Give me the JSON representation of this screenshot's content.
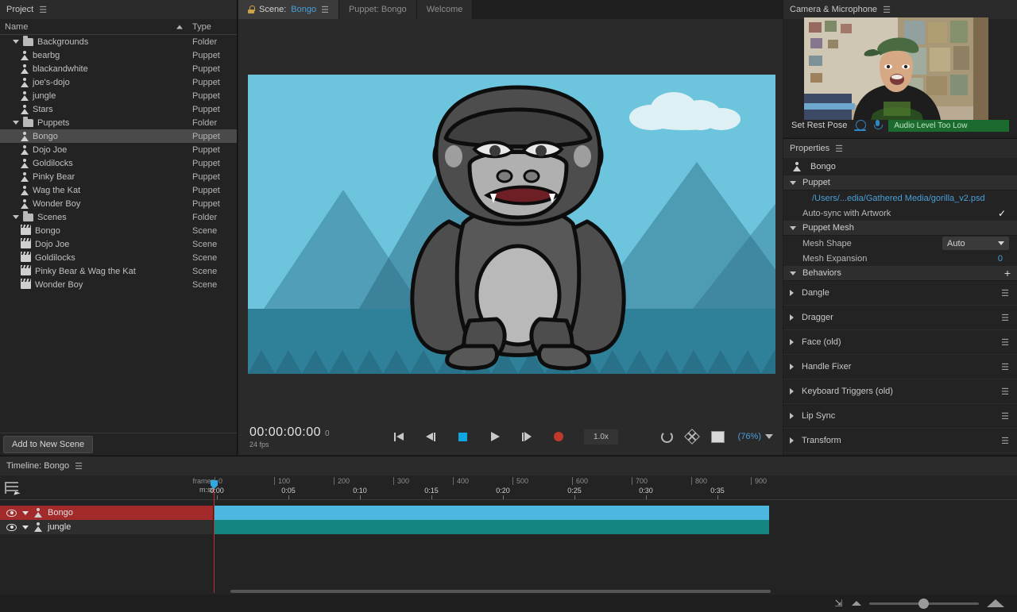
{
  "project": {
    "title": "Project",
    "columns": {
      "name": "Name",
      "type": "Type"
    },
    "add_button": "Add to New Scene",
    "items": [
      {
        "label": "Backgrounds",
        "type": "Folder",
        "kind": "folder",
        "indent": 0,
        "expanded": true,
        "selected": false
      },
      {
        "label": "bearbg",
        "type": "Puppet",
        "kind": "puppet",
        "indent": 1,
        "selected": false
      },
      {
        "label": "blackandwhite",
        "type": "Puppet",
        "kind": "puppet",
        "indent": 1,
        "selected": false
      },
      {
        "label": "joe's-dojo",
        "type": "Puppet",
        "kind": "puppet",
        "indent": 1,
        "selected": false
      },
      {
        "label": "jungle",
        "type": "Puppet",
        "kind": "puppet",
        "indent": 1,
        "selected": false
      },
      {
        "label": "Stars",
        "type": "Puppet",
        "kind": "puppet",
        "indent": 1,
        "selected": false
      },
      {
        "label": "Puppets",
        "type": "Folder",
        "kind": "folder",
        "indent": 0,
        "expanded": true,
        "selected": false
      },
      {
        "label": "Bongo",
        "type": "Puppet",
        "kind": "puppet",
        "indent": 1,
        "selected": true
      },
      {
        "label": "Dojo Joe",
        "type": "Puppet",
        "kind": "puppet",
        "indent": 1,
        "selected": false
      },
      {
        "label": "Goldilocks",
        "type": "Puppet",
        "kind": "puppet",
        "indent": 1,
        "selected": false
      },
      {
        "label": "Pinky Bear",
        "type": "Puppet",
        "kind": "puppet",
        "indent": 1,
        "selected": false
      },
      {
        "label": "Wag the Kat",
        "type": "Puppet",
        "kind": "puppet",
        "indent": 1,
        "selected": false
      },
      {
        "label": "Wonder Boy",
        "type": "Puppet",
        "kind": "puppet",
        "indent": 1,
        "selected": false
      },
      {
        "label": "Scenes",
        "type": "Folder",
        "kind": "folder",
        "indent": 0,
        "expanded": true,
        "selected": false
      },
      {
        "label": "Bongo",
        "type": "Scene",
        "kind": "scene",
        "indent": 1,
        "selected": false
      },
      {
        "label": "Dojo Joe",
        "type": "Scene",
        "kind": "scene",
        "indent": 1,
        "selected": false
      },
      {
        "label": "Goldilocks",
        "type": "Scene",
        "kind": "scene",
        "indent": 1,
        "selected": false
      },
      {
        "label": "Pinky Bear & Wag the Kat",
        "type": "Scene",
        "kind": "scene",
        "indent": 1,
        "selected": false
      },
      {
        "label": "Wonder Boy",
        "type": "Scene",
        "kind": "scene",
        "indent": 1,
        "selected": false
      }
    ]
  },
  "tabs": [
    {
      "prefix": "Scene:",
      "name": "Bongo",
      "active": true,
      "locked": true
    },
    {
      "prefix": "Puppet: Bongo",
      "name": "",
      "active": false,
      "locked": false
    },
    {
      "prefix": "Welcome",
      "name": "",
      "active": false,
      "locked": false
    }
  ],
  "transport": {
    "timecode": "00:00:00:00",
    "frame": "0",
    "fps": "24 fps",
    "speed": "1.0x",
    "zoom": "(76%)",
    "buttons": {
      "go_to_start": "go-to-start",
      "step_back": "step-back",
      "stop": "stop",
      "play": "play",
      "step_forward": "step-forward",
      "record": "record"
    }
  },
  "camera": {
    "title": "Camera & Microphone",
    "set_rest_pose": "Set Rest Pose",
    "audio_status": "Audio Level Too Low"
  },
  "properties": {
    "title": "Properties",
    "puppet_name": "Bongo",
    "sections": {
      "puppet": "Puppet",
      "puppet_mesh": "Puppet Mesh",
      "behaviors": "Behaviors"
    },
    "source_path": "/Users/...edia/Gathered Media/gorilla_v2.psd",
    "auto_sync_label": "Auto-sync with Artwork",
    "auto_sync_checked": "✓",
    "mesh_shape_label": "Mesh Shape",
    "mesh_shape_value": "Auto",
    "mesh_expansion_label": "Mesh Expansion",
    "mesh_expansion_value": "0",
    "add_behavior": "+",
    "behaviors": [
      {
        "label": "Dangle"
      },
      {
        "label": "Dragger"
      },
      {
        "label": "Face (old)"
      },
      {
        "label": "Handle Fixer"
      },
      {
        "label": "Keyboard Triggers (old)"
      },
      {
        "label": "Lip Sync"
      },
      {
        "label": "Transform"
      }
    ]
  },
  "timeline": {
    "title": "Timeline: Bongo",
    "ruler_row1_label": "frames",
    "ruler_row2_label": "m:ss",
    "frame_ticks": [
      "0",
      "100",
      "200",
      "300",
      "400",
      "500",
      "600",
      "700",
      "800",
      "900"
    ],
    "second_ticks": [
      "0:00",
      "0:05",
      "0:10",
      "0:15",
      "0:20",
      "0:25",
      "0:30",
      "0:35"
    ],
    "tracks": [
      {
        "label": "Bongo",
        "selected": true,
        "clip_color": "blue"
      },
      {
        "label": "jungle",
        "selected": false,
        "clip_color": "teal"
      }
    ]
  },
  "colors": {
    "accent_blue": "#4a9fd8",
    "selected_track_red": "#a32a2a",
    "clip_blue": "#4cb8e0",
    "clip_teal": "#15857f",
    "record_red": "#c0392b",
    "audio_green": "#1c6b2e",
    "sky": "#6cc5dd",
    "ground": "#2f8099"
  }
}
